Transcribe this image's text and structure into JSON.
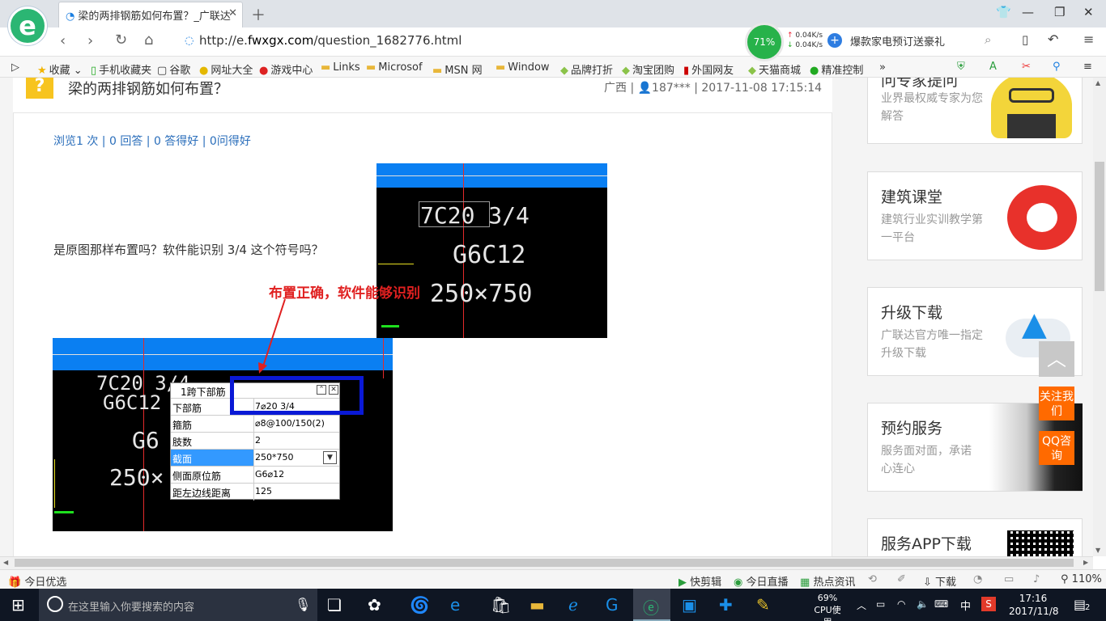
{
  "browser": {
    "tab_title": "梁的两排钢筋如何布置？_广联达",
    "url_prefix": "http://e.",
    "url_host": "fwxgx.com",
    "url_path": "/question_1682776.html",
    "speed_percent": "71%",
    "speed_up": "0.04K/s",
    "speed_down": "0.04K/s",
    "promo": "爆款家电预订送豪礼",
    "bookmarks": [
      "收藏",
      "手机收藏夹",
      "谷歌",
      "网址大全",
      "游戏中心",
      "Links",
      "Microsof",
      "MSN 网",
      "Window",
      "品牌打折",
      "淘宝团购",
      "外国网友",
      "天猫商城",
      "精准控制"
    ]
  },
  "question": {
    "title": "梁的两排钢筋如何布置？",
    "meta": "广西 | 👤187*** | 2017-11-08 17:15:14",
    "stats": "浏览1 次 | 0 回答 | 0 答得好 | 0问得好",
    "body": "是原图那样布置吗？软件能识别 3/4 这个符号吗？"
  },
  "cad_top": {
    "line1": "7C20 3/4",
    "line2": "G6C12",
    "line3": "250×750"
  },
  "annotation": "布置正确，软件能够识别",
  "cad_bottom": {
    "text1": "7C20 3/4",
    "text2": "G6C12",
    "text3": "G6",
    "text4": "250×",
    "dialog_title": "1跨下部筋",
    "rows": [
      {
        "k": "下部筋",
        "v": "7⌀20 3/4"
      },
      {
        "k": "箍筋",
        "v": "⌀8@100/150(2)"
      },
      {
        "k": "肢数",
        "v": "2"
      },
      {
        "k": "截面",
        "v": "250*750"
      },
      {
        "k": "侧面原位筋",
        "v": "G6⌀12"
      },
      {
        "k": "距左边线距离",
        "v": "125"
      }
    ]
  },
  "sidebar": [
    {
      "title": "问专家提问",
      "sub": "业界最权威专家为您解答"
    },
    {
      "title": "建筑课堂",
      "sub": "建筑行业实训教学第一平台"
    },
    {
      "title": "升级下载",
      "sub": "广联达官方唯一指定升级下载"
    },
    {
      "title": "预约服务",
      "sub": "服务面对面，承诺心连心"
    },
    {
      "title": "服务APP下载",
      "sub": ""
    }
  ],
  "float": {
    "follow": "关注我们",
    "qq": "QQ咨询"
  },
  "statusbar": {
    "left": "今日优选",
    "items": [
      "快剪辑",
      "今日直播",
      "热点资讯",
      "下载"
    ],
    "zoom": "110%"
  },
  "taskbar": {
    "search_placeholder": "在这里输入你要搜索的内容",
    "cpu_percent": "69%",
    "cpu_label": "CPU使用",
    "ime": "中",
    "time": "17:16",
    "date": "2017/11/8",
    "notif_count": "2"
  }
}
